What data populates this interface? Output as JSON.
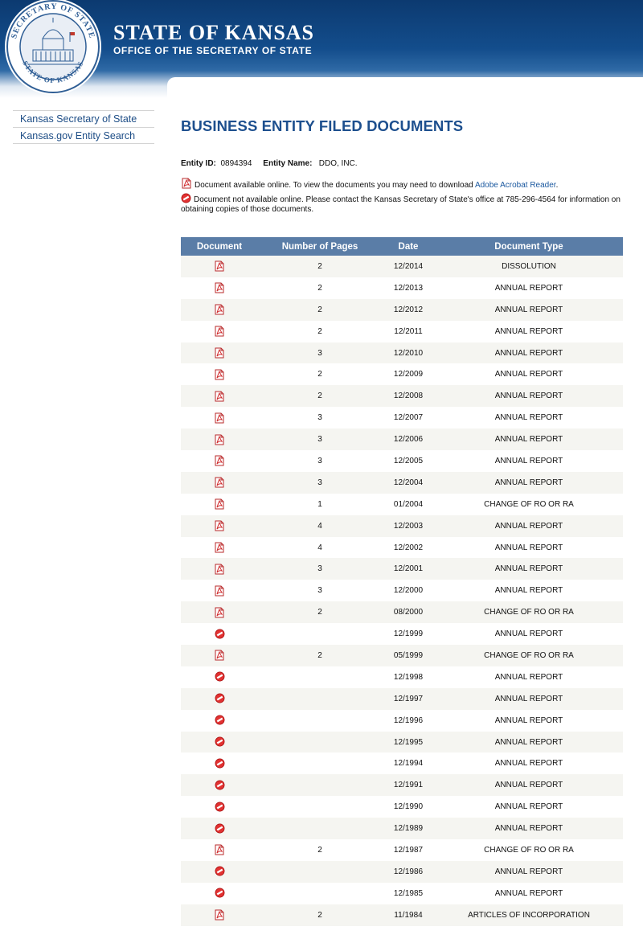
{
  "header": {
    "title": "STATE OF KANSAS",
    "subtitle": "OFFICE OF THE SECRETARY OF STATE",
    "seal_text_top": "SECRETARY OF STATE",
    "seal_text_bottom": "STATE OF KANSAS"
  },
  "sidebar": {
    "items": [
      {
        "label": "Kansas Secretary of State"
      },
      {
        "label": "Kansas.gov Entity Search"
      }
    ]
  },
  "main": {
    "title": "BUSINESS ENTITY FILED DOCUMENTS",
    "entity_id_label": "Entity ID:",
    "entity_id": "0894394",
    "entity_name_label": "Entity Name:",
    "entity_name": "DDO, INC.",
    "legend_available_text": "Document available online. To view the documents you may need to download",
    "legend_available_link": "Adobe Acrobat Reader",
    "legend_available_end": ".",
    "legend_unavailable_text": "Document not available online. Please contact the Kansas Secretary of State's office at 785-296-4564 for information on obtaining copies of those documents."
  },
  "table": {
    "headers": [
      "Document",
      "Number of Pages",
      "Date",
      "Document Type"
    ],
    "rows": [
      {
        "icon": "pdf-icon",
        "pages": "2",
        "date": "12/2014",
        "type": "DISSOLUTION"
      },
      {
        "icon": "pdf-icon",
        "pages": "2",
        "date": "12/2013",
        "type": "ANNUAL REPORT"
      },
      {
        "icon": "pdf-icon",
        "pages": "2",
        "date": "12/2012",
        "type": "ANNUAL REPORT"
      },
      {
        "icon": "pdf-icon",
        "pages": "2",
        "date": "12/2011",
        "type": "ANNUAL REPORT"
      },
      {
        "icon": "pdf-icon",
        "pages": "3",
        "date": "12/2010",
        "type": "ANNUAL REPORT"
      },
      {
        "icon": "pdf-icon",
        "pages": "2",
        "date": "12/2009",
        "type": "ANNUAL REPORT"
      },
      {
        "icon": "pdf-icon",
        "pages": "2",
        "date": "12/2008",
        "type": "ANNUAL REPORT"
      },
      {
        "icon": "pdf-icon",
        "pages": "3",
        "date": "12/2007",
        "type": "ANNUAL REPORT"
      },
      {
        "icon": "pdf-icon",
        "pages": "3",
        "date": "12/2006",
        "type": "ANNUAL REPORT"
      },
      {
        "icon": "pdf-icon",
        "pages": "3",
        "date": "12/2005",
        "type": "ANNUAL REPORT"
      },
      {
        "icon": "pdf-icon",
        "pages": "3",
        "date": "12/2004",
        "type": "ANNUAL REPORT"
      },
      {
        "icon": "pdf-icon",
        "pages": "1",
        "date": "01/2004",
        "type": "CHANGE OF RO OR RA"
      },
      {
        "icon": "pdf-icon",
        "pages": "4",
        "date": "12/2003",
        "type": "ANNUAL REPORT"
      },
      {
        "icon": "pdf-icon",
        "pages": "4",
        "date": "12/2002",
        "type": "ANNUAL REPORT"
      },
      {
        "icon": "pdf-icon",
        "pages": "3",
        "date": "12/2001",
        "type": "ANNUAL REPORT"
      },
      {
        "icon": "pdf-icon",
        "pages": "3",
        "date": "12/2000",
        "type": "ANNUAL REPORT"
      },
      {
        "icon": "pdf-icon",
        "pages": "2",
        "date": "08/2000",
        "type": "CHANGE OF RO OR RA"
      },
      {
        "icon": "unavailable-icon",
        "pages": "",
        "date": "12/1999",
        "type": "ANNUAL REPORT"
      },
      {
        "icon": "pdf-icon",
        "pages": "2",
        "date": "05/1999",
        "type": "CHANGE OF RO OR RA"
      },
      {
        "icon": "unavailable-icon",
        "pages": "",
        "date": "12/1998",
        "type": "ANNUAL REPORT"
      },
      {
        "icon": "unavailable-icon",
        "pages": "",
        "date": "12/1997",
        "type": "ANNUAL REPORT"
      },
      {
        "icon": "unavailable-icon",
        "pages": "",
        "date": "12/1996",
        "type": "ANNUAL REPORT"
      },
      {
        "icon": "unavailable-icon",
        "pages": "",
        "date": "12/1995",
        "type": "ANNUAL REPORT"
      },
      {
        "icon": "unavailable-icon",
        "pages": "",
        "date": "12/1994",
        "type": "ANNUAL REPORT"
      },
      {
        "icon": "unavailable-icon",
        "pages": "",
        "date": "12/1991",
        "type": "ANNUAL REPORT"
      },
      {
        "icon": "unavailable-icon",
        "pages": "",
        "date": "12/1990",
        "type": "ANNUAL REPORT"
      },
      {
        "icon": "unavailable-icon",
        "pages": "",
        "date": "12/1989",
        "type": "ANNUAL REPORT"
      },
      {
        "icon": "pdf-icon",
        "pages": "2",
        "date": "12/1987",
        "type": "CHANGE OF RO OR RA"
      },
      {
        "icon": "unavailable-icon",
        "pages": "",
        "date": "12/1986",
        "type": "ANNUAL REPORT"
      },
      {
        "icon": "unavailable-icon",
        "pages": "",
        "date": "12/1985",
        "type": "ANNUAL REPORT"
      },
      {
        "icon": "pdf-icon",
        "pages": "2",
        "date": "11/1984",
        "type": "ARTICLES OF INCORPORATION"
      }
    ]
  },
  "colors": {
    "header_blue": "#134d8c",
    "table_header": "#5a7da7",
    "title_blue": "#1d4f8e",
    "link_blue": "#1d5aa0",
    "row_stripe": "#f5f5f1"
  }
}
